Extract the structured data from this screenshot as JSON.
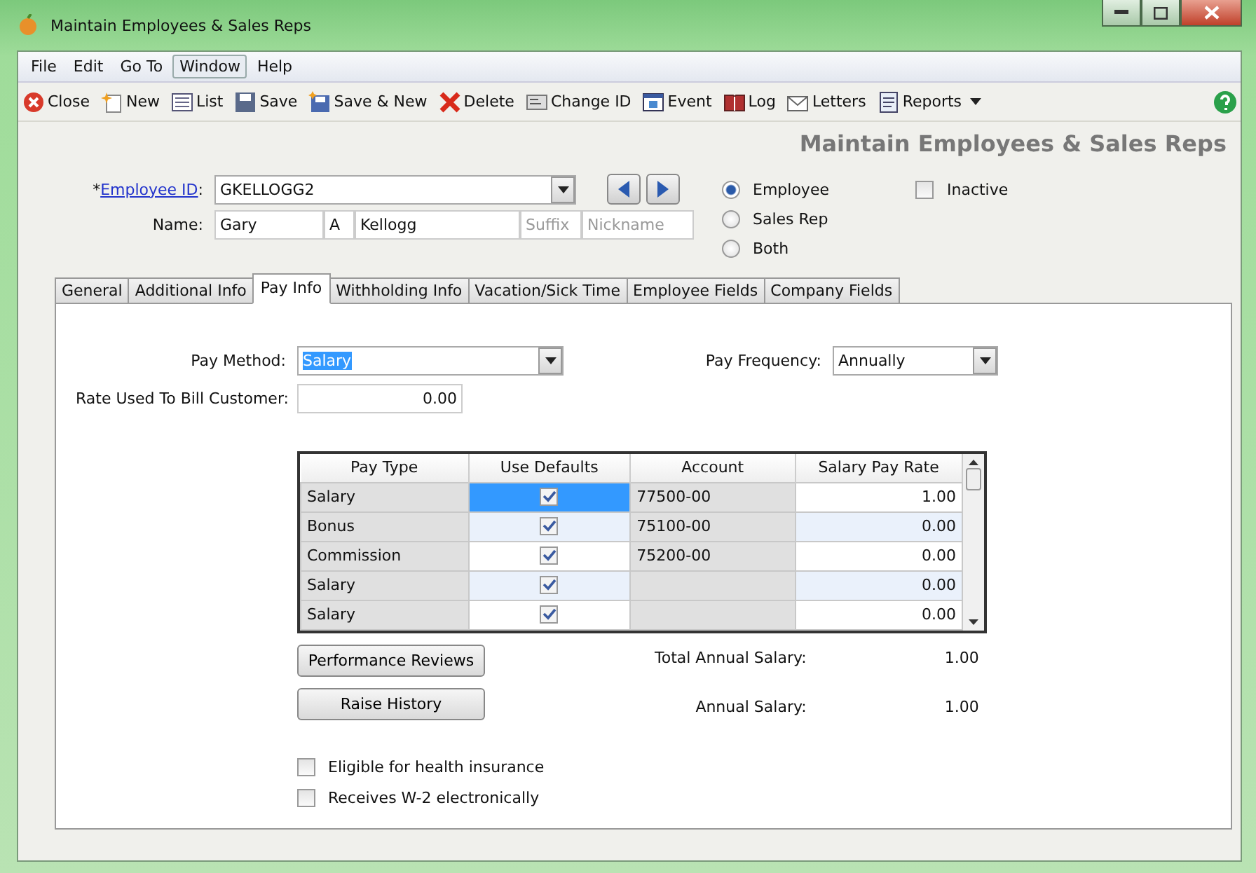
{
  "window": {
    "title": "Maintain Employees & Sales Reps"
  },
  "menu": [
    {
      "label": "File",
      "selected": false
    },
    {
      "label": "Edit",
      "selected": false
    },
    {
      "label": "Go To",
      "selected": false
    },
    {
      "label": "Window",
      "selected": true
    },
    {
      "label": "Help",
      "selected": false
    }
  ],
  "toolbar": [
    {
      "label": "Close",
      "kind": "close"
    },
    {
      "label": "New",
      "kind": "new"
    },
    {
      "label": "List",
      "kind": "list"
    },
    {
      "label": "Save",
      "kind": "save"
    },
    {
      "label": "Save & New",
      "kind": "savenew"
    },
    {
      "label": "Delete",
      "kind": "delete"
    },
    {
      "label": "Change ID",
      "kind": "changeid"
    },
    {
      "label": "Event",
      "kind": "event"
    },
    {
      "label": "Log",
      "kind": "log"
    },
    {
      "label": "Letters",
      "kind": "letters"
    },
    {
      "label": "Reports",
      "kind": "reports",
      "has_menu": true
    }
  ],
  "heading": "Maintain Employees & Sales Reps",
  "employee_id": {
    "mark": "*",
    "link": "Employee ID",
    "suffix": ":",
    "value": "GKELLOGG2"
  },
  "name": {
    "label": "Name:",
    "first": "Gary",
    "middle": "A",
    "last": "Kellogg",
    "suffix_placeholder": "Suffix",
    "nickname_placeholder": "Nickname"
  },
  "type_options": [
    {
      "label": "Employee",
      "selected": true
    },
    {
      "label": "Sales Rep",
      "selected": false
    },
    {
      "label": "Both",
      "selected": false
    }
  ],
  "inactive": {
    "label": "Inactive",
    "checked": false
  },
  "tabs": [
    {
      "label": "General",
      "selected": false
    },
    {
      "label": "Additional Info",
      "selected": false
    },
    {
      "label": "Pay Info",
      "selected": true
    },
    {
      "label": "Withholding Info",
      "selected": false
    },
    {
      "label": "Vacation/Sick Time",
      "selected": false
    },
    {
      "label": "Employee Fields",
      "selected": false
    },
    {
      "label": "Company Fields",
      "selected": false
    }
  ],
  "pay_method": {
    "label": "Pay Method:",
    "value": "Salary"
  },
  "pay_frequency": {
    "label": "Pay Frequency:",
    "value": "Annually"
  },
  "bill_rate": {
    "label": "Rate Used To Bill Customer:",
    "value": "0.00"
  },
  "table": {
    "columns": [
      "Pay Type",
      "Use Defaults",
      "Account",
      "Salary Pay Rate"
    ],
    "rows": [
      {
        "pay_type": "Salary",
        "use_defaults": true,
        "account": "77500-00",
        "rate": "1.00",
        "selected": true
      },
      {
        "pay_type": "Bonus",
        "use_defaults": true,
        "account": "75100-00",
        "rate": "0.00",
        "selected": false
      },
      {
        "pay_type": "Commission",
        "use_defaults": true,
        "account": "75200-00",
        "rate": "0.00",
        "selected": false
      },
      {
        "pay_type": "Salary",
        "use_defaults": true,
        "rate": "0.00",
        "selected": false
      },
      {
        "pay_type": "Salary",
        "use_defaults": true,
        "rate": "0.00",
        "selected": false
      }
    ]
  },
  "buttons": [
    "Performance Reviews",
    "Raise History"
  ],
  "totals": [
    {
      "label": "Total Annual Salary:",
      "value": "1.00"
    },
    {
      "label": "Annual Salary:",
      "value": "1.00"
    }
  ],
  "options": [
    {
      "label": "Eligible for health insurance",
      "checked": false
    },
    {
      "label": "Receives W-2 electronically",
      "checked": false
    }
  ]
}
